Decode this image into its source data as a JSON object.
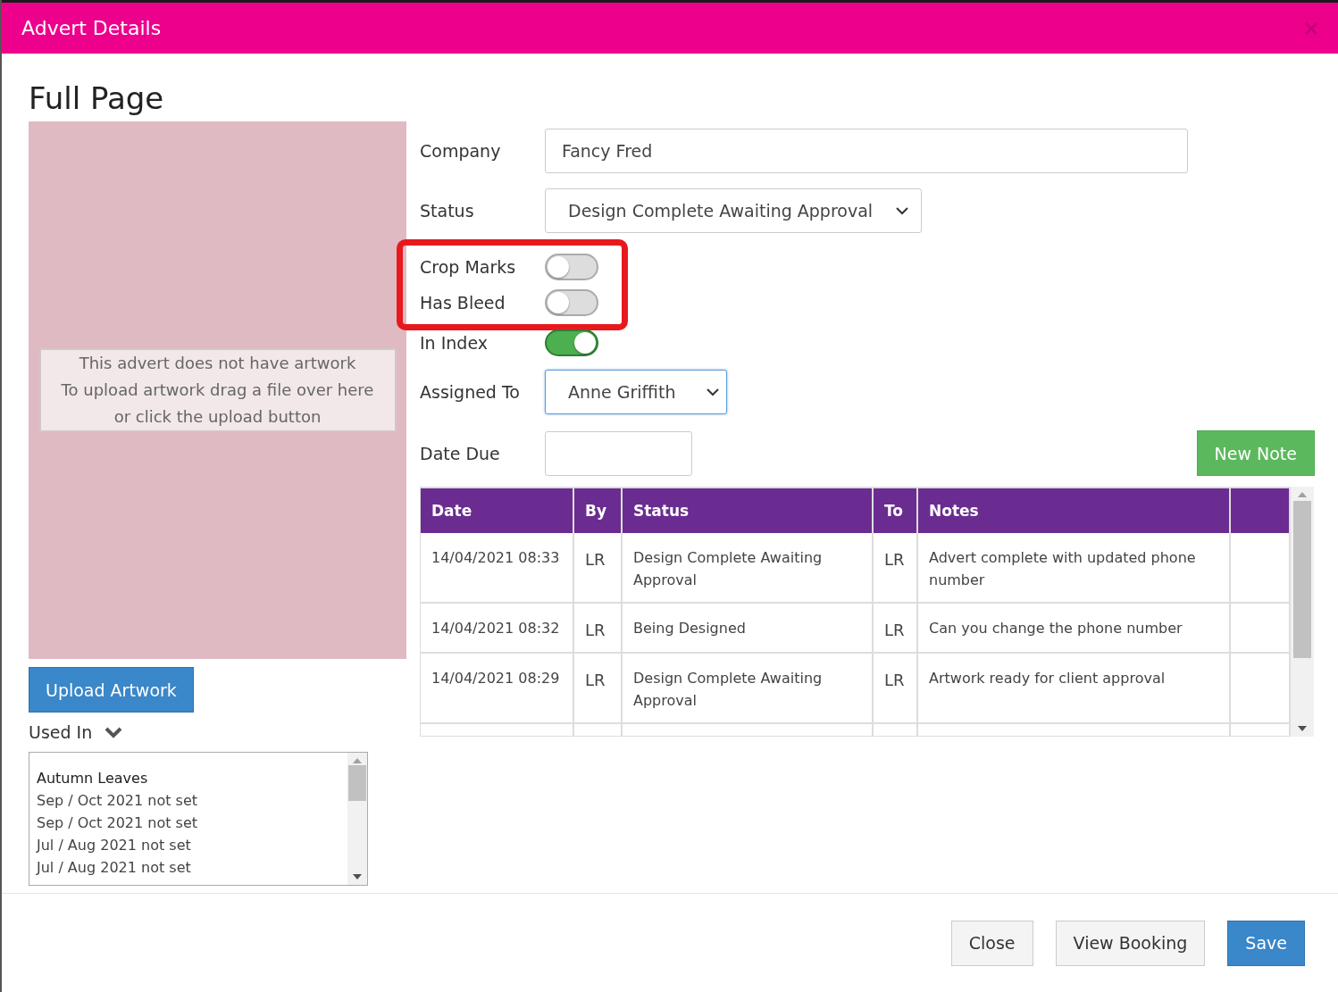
{
  "dialog": {
    "title": "Advert Details"
  },
  "advert": {
    "heading": "Full Page"
  },
  "artwork": {
    "message": [
      "This advert does not have artwork",
      "To upload artwork drag a file over here",
      "or click the upload button"
    ],
    "upload_button": "Upload Artwork"
  },
  "used_in": {
    "label": "Used In",
    "items": [
      {
        "text": "Autumn Leaves",
        "kind": "heading"
      },
      {
        "text": "Sep / Oct 2021 not set",
        "kind": "issue"
      },
      {
        "text": "Sep / Oct 2021 not set",
        "kind": "issue"
      },
      {
        "text": "Jul / Aug 2021 not set",
        "kind": "issue"
      },
      {
        "text": "Jul / Aug 2021 not set",
        "kind": "issue"
      }
    ]
  },
  "form": {
    "company": {
      "label": "Company",
      "value": "Fancy Fred"
    },
    "status": {
      "label": "Status",
      "value": "Design Complete Awaiting Approval"
    },
    "toggles": [
      {
        "label": "Crop Marks",
        "on": false,
        "highlighted": true
      },
      {
        "label": "Has Bleed",
        "on": false,
        "highlighted": true
      },
      {
        "label": "In Index",
        "on": true,
        "highlighted": false
      }
    ],
    "assigned_to": {
      "label": "Assigned To",
      "value": "Anne Griffith",
      "focused": true
    },
    "date_due": {
      "label": "Date Due"
    }
  },
  "new_note_button": "New Note",
  "notes_table": {
    "columns": [
      "Date",
      "By",
      "Status",
      "To",
      "Notes"
    ],
    "rows": [
      {
        "date": "14/04/2021 08:33",
        "by": "LR",
        "status": "Design Complete Awaiting Approval",
        "to": "LR",
        "notes": "Advert complete with updated phone number"
      },
      {
        "date": "14/04/2021 08:32",
        "by": "LR",
        "status": "Being Designed",
        "to": "LR",
        "notes": "Can you change the phone number"
      },
      {
        "date": "14/04/2021 08:29",
        "by": "LR",
        "status": "Design Complete Awaiting Approval",
        "to": "LR",
        "notes": "Artwork ready for client approval"
      }
    ]
  },
  "footer": {
    "buttons": [
      {
        "label": "Close",
        "kind": "default"
      },
      {
        "label": "View Booking",
        "kind": "default"
      },
      {
        "label": "Save",
        "kind": "primary"
      }
    ]
  }
}
